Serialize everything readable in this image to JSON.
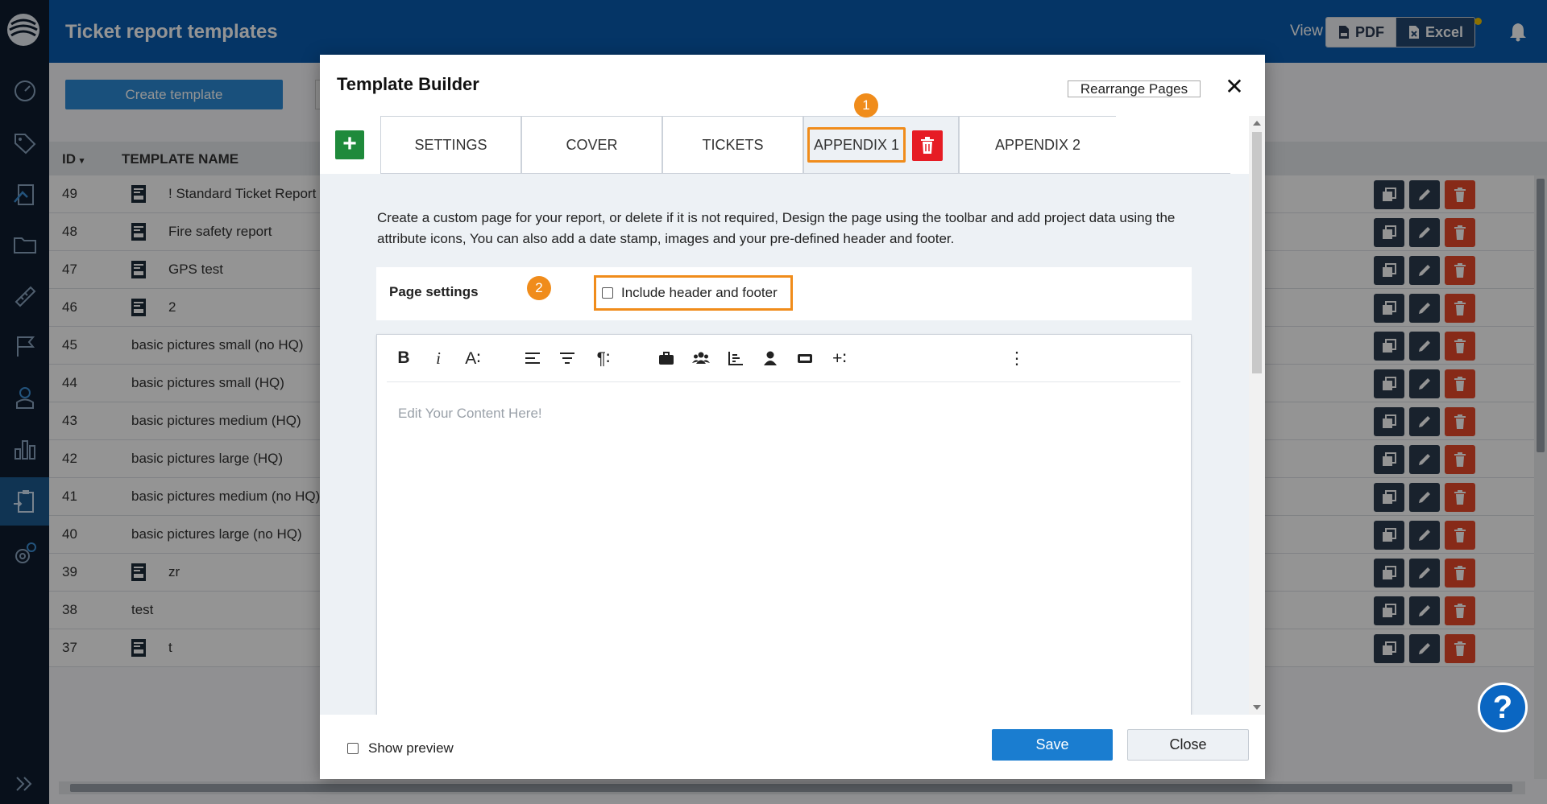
{
  "app": {
    "title": "Ticket report templates",
    "view_label": "View",
    "view_options": [
      "PDF",
      "Excel"
    ],
    "accent": "#0a5cb0"
  },
  "sidebar": {
    "items": [
      {
        "icon": "gauge-icon"
      },
      {
        "icon": "tags-icon"
      },
      {
        "icon": "plans-icon"
      },
      {
        "icon": "folder-icon"
      },
      {
        "icon": "ruler-icon"
      },
      {
        "icon": "flag-icon"
      },
      {
        "icon": "person-icon"
      },
      {
        "icon": "chart-icon"
      },
      {
        "icon": "report-icon",
        "active": true
      },
      {
        "icon": "settings-icon"
      }
    ],
    "expand_icon": "double-chevron-right-icon"
  },
  "page": {
    "create_button": "Create template",
    "columns": {
      "id": "ID",
      "name": "TEMPLATE NAME"
    },
    "rows": [
      {
        "id": "49",
        "name": "! Standard Ticket Report",
        "icon": true
      },
      {
        "id": "48",
        "name": "Fire safety report",
        "icon": true
      },
      {
        "id": "47",
        "name": "GPS test",
        "icon": true
      },
      {
        "id": "46",
        "name": "2",
        "icon": true
      },
      {
        "id": "45",
        "name": "basic pictures small (no HQ)",
        "icon": false
      },
      {
        "id": "44",
        "name": "basic pictures small (HQ)",
        "icon": false
      },
      {
        "id": "43",
        "name": "basic pictures medium (HQ)",
        "icon": false
      },
      {
        "id": "42",
        "name": "basic pictures large (HQ)",
        "icon": false
      },
      {
        "id": "41",
        "name": "basic pictures medium (no HQ)",
        "icon": false
      },
      {
        "id": "40",
        "name": "basic pictures large (no HQ)",
        "icon": false
      },
      {
        "id": "39",
        "name": "zr",
        "icon": true
      },
      {
        "id": "38",
        "name": "test",
        "icon": false
      },
      {
        "id": "37",
        "name": "t",
        "icon": true
      }
    ]
  },
  "modal": {
    "title": "Template Builder",
    "rearrange_button": "Rearrange Pages",
    "tabs": [
      "SETTINGS",
      "COVER",
      "TICKETS",
      "APPENDIX 1",
      "APPENDIX 2"
    ],
    "active_tab": "APPENDIX 1",
    "badges": [
      "1",
      "2"
    ],
    "description": "Create a custom page for your report, or delete if it is not required, Design the page using the toolbar and add project data using the attribute icons, You can also add a date stamp, images and your pre-defined header and footer.",
    "page_settings_label": "Page settings",
    "include_header_footer": "Include header and footer",
    "toolbar": {
      "bold": "B",
      "italic": "i",
      "font_size": "A∶",
      "paragraph": "¶∶",
      "insert": "+∶",
      "more": "⋮"
    },
    "editor_placeholder": "Edit Your Content Here!",
    "show_preview": "Show preview",
    "save_button": "Save",
    "close_button": "Close",
    "help": "?"
  }
}
